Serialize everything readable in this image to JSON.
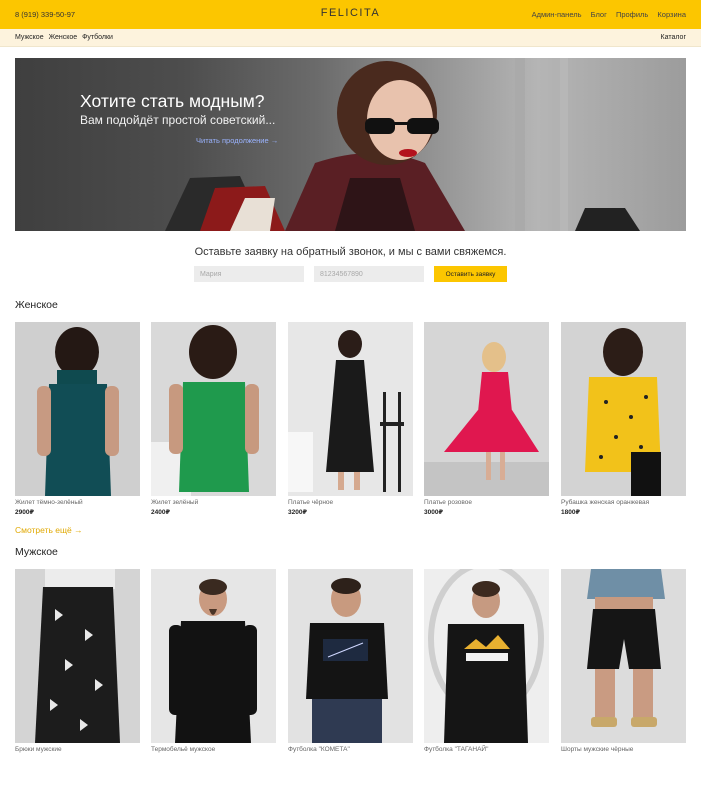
{
  "header": {
    "phone": "8 (919) 339-50-97",
    "brand": "FELICITA",
    "nav": [
      "Админ-панель",
      "Блог",
      "Профиль",
      "Корзина"
    ]
  },
  "subnav": {
    "categories": [
      "Мужское",
      "Женское",
      "Футболки"
    ],
    "catalog": "Каталог"
  },
  "hero": {
    "title": "Хотите стать модным?",
    "subtitle": "Вам подойдёт простой советский...",
    "link": "Читать продолжение →"
  },
  "callback": {
    "text": "Оставьте заявку на обратный звонок, и мы с вами свяжемся.",
    "name_placeholder": "Мария",
    "phone_placeholder": "81234567890",
    "button": "Оставить заявку"
  },
  "women": {
    "title": "Женское",
    "see_more": "Смотреть ещё →",
    "products": [
      {
        "name": "Жилет тёмно-зелёный",
        "price": "2900₽"
      },
      {
        "name": "Жилет зелёный",
        "price": "2400₽"
      },
      {
        "name": "Платье чёрное",
        "price": "3200₽"
      },
      {
        "name": "Платье розовое",
        "price": "3000₽"
      },
      {
        "name": "Рубашка женская оранжевая",
        "price": "1800₽"
      }
    ]
  },
  "men": {
    "title": "Мужское",
    "products": [
      {
        "name": "Брюки мужские"
      },
      {
        "name": "Термобельё мужское"
      },
      {
        "name": "Футболка \"КОМЕТА\""
      },
      {
        "name": "Футболка \"ТАГАНАЙ\""
      },
      {
        "name": "Шорты мужские чёрные"
      }
    ]
  },
  "colors": {
    "accent": "#fcc600",
    "subnav_bg": "#fdf3dd",
    "link": "#9ab3ff",
    "see_more": "#e0a800"
  }
}
